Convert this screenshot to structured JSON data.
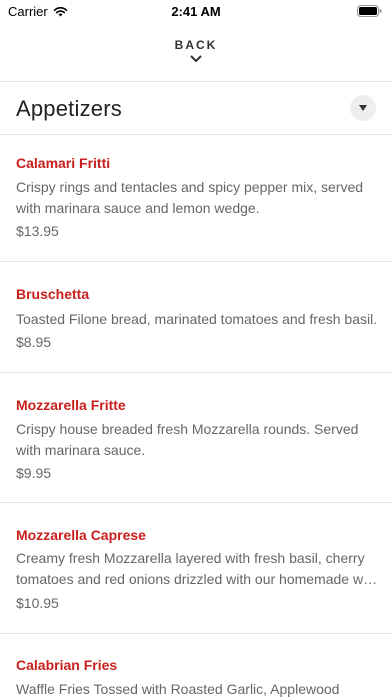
{
  "status_bar": {
    "carrier": "Carrier",
    "time": "2:41 AM",
    "wifi_icon": "wifi-icon",
    "battery_icon": "battery-icon"
  },
  "nav": {
    "back_label": "BACK",
    "back_icon": "chevron-down-icon"
  },
  "section": {
    "title": "Appetizers",
    "toggle_icon": "caret-down-icon"
  },
  "menu_items": [
    {
      "name": "Calamari Fritti",
      "description": "Crispy rings and tentacles and spicy pepper mix, served with marinara sauce and lemon wedge.",
      "price": "$13.95"
    },
    {
      "name": "Bruschetta",
      "description": "Toasted Filone bread, marinated tomatoes and fresh basil.",
      "price": "$8.95"
    },
    {
      "name": "Mozzarella Fritte",
      "description": "Crispy house breaded fresh Mozzarella rounds. Served with marinara sauce.",
      "price": "$9.95"
    },
    {
      "name": "Mozzarella Caprese",
      "description": "Creamy fresh Mozzarella layered with fresh basil, cherry tomatoes and red onions drizzled with our homemade w…",
      "price": "$10.95"
    },
    {
      "name": "Calabrian Fries",
      "description": "Waffle Fries Tossed with Roasted Garlic, Applewood"
    }
  ],
  "colors": {
    "item_name": "#c8201c",
    "description": "#666666",
    "divider": "#e6e6e6"
  }
}
